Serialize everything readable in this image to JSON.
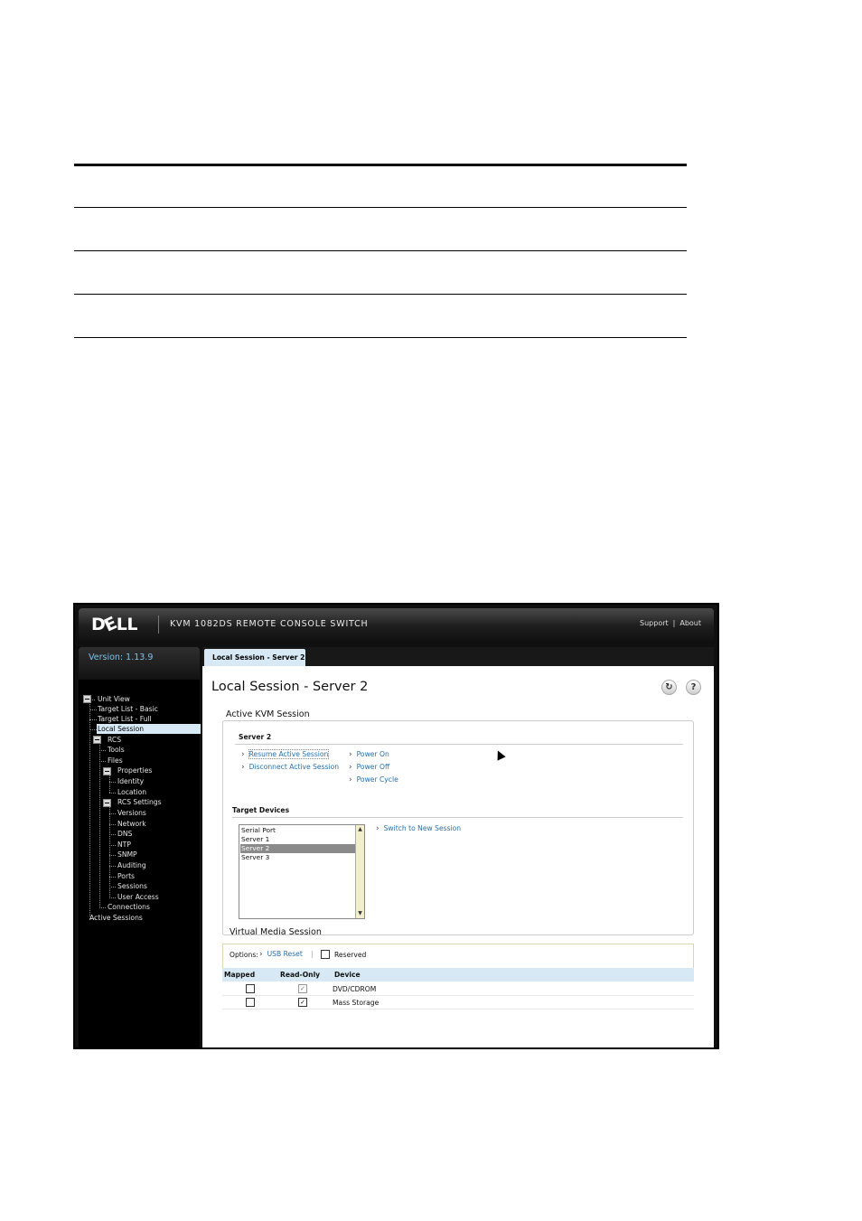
{
  "header": {
    "logo": "DELL",
    "title": "KVM 1082DS REMOTE CONSOLE SWITCH",
    "support": "Support",
    "separator": "|",
    "about": "About"
  },
  "sidebar": {
    "version": "Version: 1.13.9",
    "items": [
      {
        "label": "Unit View"
      },
      {
        "label": "Target List - Basic"
      },
      {
        "label": "Target List - Full"
      },
      {
        "label": "Local Session",
        "selected": true
      },
      {
        "label": "RCS"
      },
      {
        "label": "Tools"
      },
      {
        "label": "Files"
      },
      {
        "label": "Properties"
      },
      {
        "label": "Identity"
      },
      {
        "label": "Location"
      },
      {
        "label": "RCS Settings"
      },
      {
        "label": "Versions"
      },
      {
        "label": "Network"
      },
      {
        "label": "DNS"
      },
      {
        "label": "NTP"
      },
      {
        "label": "SNMP"
      },
      {
        "label": "Auditing"
      },
      {
        "label": "Ports"
      },
      {
        "label": "Sessions"
      },
      {
        "label": "User Access"
      },
      {
        "label": "Connections"
      },
      {
        "label": "Active Sessions"
      }
    ]
  },
  "main": {
    "tab": "Local Session - Server 2",
    "page_title": "Local Session - Server 2",
    "refresh_icon": "refresh-icon",
    "help_icon": "help-icon",
    "kvm": {
      "heading": "Active KVM Session",
      "server_label": "Server 2",
      "actions_left": [
        "Resume Active Session",
        "Disconnect Active Session"
      ],
      "actions_right": [
        "Power On",
        "Power Off",
        "Power Cycle"
      ],
      "target_heading": "Target Devices",
      "targets": [
        "Serial Port",
        "Server 1",
        "Server 2",
        "Server 3"
      ],
      "selected_target": "Server 2",
      "switch_link": "Switch to New Session"
    },
    "vm": {
      "heading": "Virtual Media Session",
      "options_label": "Options:",
      "usb_reset": "USB Reset",
      "separator": "|",
      "reserved_label": "Reserved",
      "reserved_checked": false,
      "columns": [
        "Mapped",
        "Read-Only",
        "Device"
      ],
      "rows": [
        {
          "mapped": false,
          "read_only": true,
          "device": "DVD/CDROM"
        },
        {
          "mapped": false,
          "read_only": true,
          "device": "Mass Storage"
        }
      ]
    }
  },
  "colors": {
    "accent_link": "#2a6fa8",
    "selection": "#d6e9f5",
    "version_text": "#7fc3ea"
  }
}
